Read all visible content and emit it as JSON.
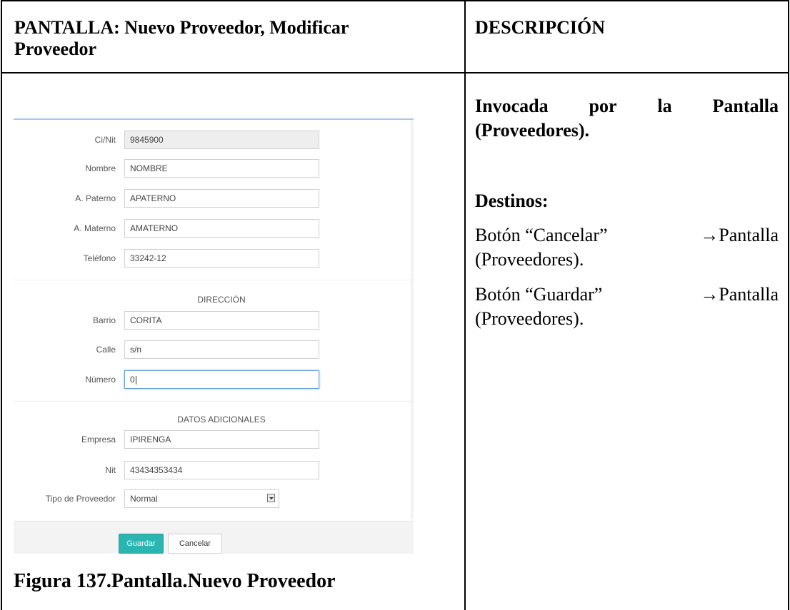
{
  "header": {
    "screen_line1": "PANTALLA: Nuevo Proveedor, Modificar",
    "screen_line2": "Proveedor",
    "description_title": "DESCRIPCIÓN"
  },
  "description": {
    "invoked_line1_a": "Invocada",
    "invoked_line1_b": "por",
    "invoked_line1_c": "la",
    "invoked_line1_d": "Pantalla",
    "invoked_line2": "(Proveedores).",
    "destinos_title": "Destinos:",
    "dest1_button": "Botón “Cancelar”",
    "dest1_target": "→Pantalla",
    "dest1_line2": "(Proveedores).",
    "dest2_button": "Botón “Guardar”",
    "dest2_target": "→Pantalla",
    "dest2_line2": "(Proveedores)."
  },
  "form": {
    "fields": [
      {
        "label": "Ci/Nit",
        "value": "9845900"
      },
      {
        "label": "Nombre",
        "value": "NOMBRE"
      },
      {
        "label": "A. Paterno",
        "value": "APATERNO"
      },
      {
        "label": "A. Materno",
        "value": "AMATERNO"
      },
      {
        "label": "Teléfono",
        "value": "33242-12"
      }
    ],
    "section_address": "DIRECCIÓN",
    "address_fields": [
      {
        "label": "Barrio",
        "value": "CORITA"
      },
      {
        "label": "Calle",
        "value": "s/n"
      },
      {
        "label": "Número",
        "value": "0"
      }
    ],
    "section_extra": "DATOS ADICIONALES",
    "extra_fields": [
      {
        "label": "Empresa",
        "value": "IPIRENGA"
      },
      {
        "label": "Nit",
        "value": "43434353434"
      }
    ],
    "provider_type_label": "Tipo de Proveedor",
    "provider_type_value": "Normal",
    "save_label": "Guardar",
    "cancel_label": "Cancelar"
  },
  "caption": "Figura 137.Pantalla.Nuevo Proveedor"
}
